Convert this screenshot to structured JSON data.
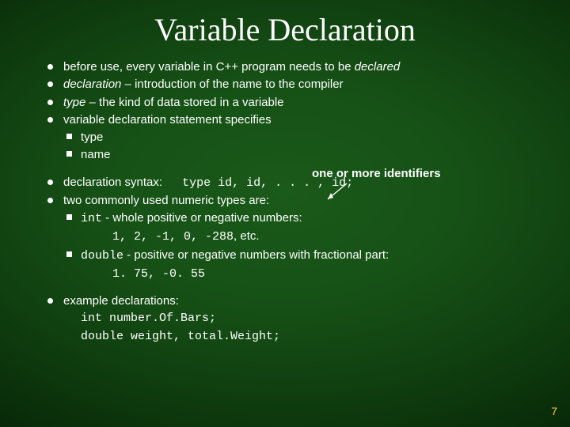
{
  "title": "Variable Declaration",
  "bullets": {
    "l1": "before use, every variable in C++ program needs to be ",
    "l1_em": "declared",
    "l2_em": "declaration",
    "l2_rest": " – introduction of the name to the compiler",
    "l3_em": "type",
    "l3_rest": " – the  kind of data stored in a variable",
    "l4": "variable declaration statement specifies",
    "l4a": "type",
    "l4b": "name",
    "note": "one or more identifiers",
    "l5a": "declaration syntax:",
    "l5b": "type id, id, . . . , id;",
    "l6": "two commonly used numeric types are:",
    "l6a_code": "int",
    "l6a_rest": " - whole positive or negative numbers:",
    "l6a_ex_code": "1, 2, -1, 0, -288",
    "l6a_ex_tail": ", etc.",
    "l6b_code": "double",
    "l6b_rest": " - positive or negative numbers with fractional part:",
    "l6b_ex": "1. 75, -0. 55",
    "l7": "example declarations:",
    "l7a": "int number.Of.Bars;",
    "l7b": "double weight, total.Weight;"
  },
  "page": "7"
}
